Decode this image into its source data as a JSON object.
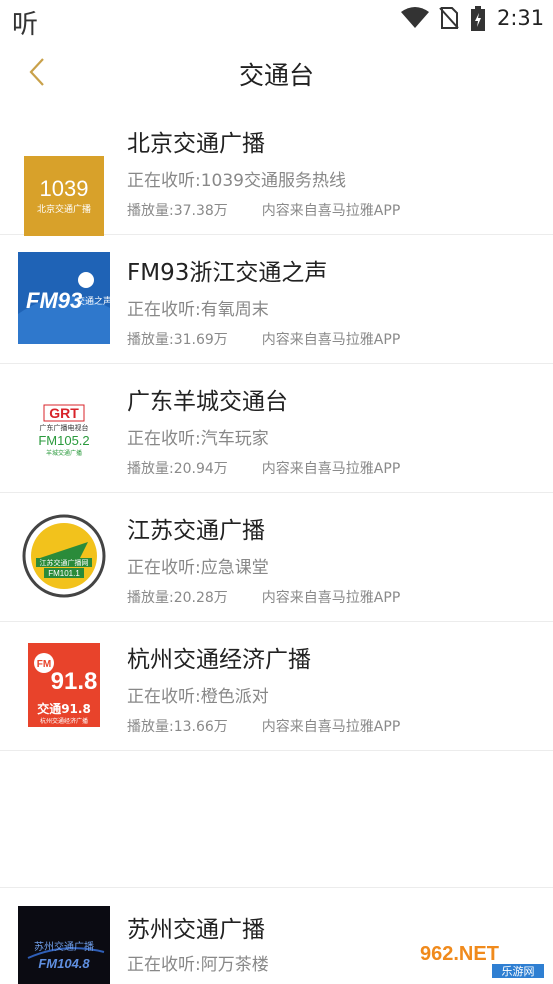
{
  "status_bar": {
    "app_glyph": "听",
    "time": "2:31",
    "icons": [
      "wifi-icon",
      "no-sim-icon",
      "battery-charging-icon"
    ]
  },
  "header": {
    "back_icon": "chevron-left-icon",
    "title": "交通台"
  },
  "stations": [
    {
      "name": "北京交通广播",
      "now_playing_prefix": "正在收听:",
      "now_playing": "1039交通服务热线",
      "plays": "播放量:37.38万",
      "source": "内容来自喜马拉雅APP",
      "logo": {
        "main": "1039",
        "sub": "北京交通广播",
        "bg": "#d8a12a",
        "fg": "#ffffff"
      }
    },
    {
      "name": "FM93浙江交通之声",
      "now_playing_prefix": "正在收听:",
      "now_playing": "有氧周末",
      "plays": "播放量:31.69万",
      "source": "内容来自喜马拉雅APP",
      "logo": {
        "main": "FM93",
        "sub": "交通之声",
        "bg": "#1f63b6",
        "fg": "#ffffff"
      }
    },
    {
      "name": "广东羊城交通台",
      "now_playing_prefix": "正在收听:",
      "now_playing": "汽车玩家",
      "plays": "播放量:20.94万",
      "source": "内容来自喜马拉雅APP",
      "logo": {
        "main": "GRT",
        "sub": "FM105.2",
        "line1": "广东广播电视台",
        "line2": "羊城交通广播",
        "bg": "#ffffff",
        "fg": "#2a9a3c",
        "accent": "#d8232a"
      }
    },
    {
      "name": "江苏交通广播",
      "now_playing_prefix": "正在收听:",
      "now_playing": "应急课堂",
      "plays": "播放量:20.28万",
      "source": "内容来自喜马拉雅APP",
      "logo": {
        "main": "江苏交通广播网",
        "sub": "FM101.1",
        "bg": "#ffffff",
        "fg": "#2a8b3a",
        "accent": "#f2c21c"
      }
    },
    {
      "name": "杭州交通经济广播",
      "now_playing_prefix": "正在收听:",
      "now_playing": "橙色派对",
      "plays": "播放量:13.66万",
      "source": "内容来自喜马拉雅APP",
      "logo": {
        "main": "91.8",
        "badge": "FM",
        "sub": "交通91.8",
        "line1": "杭州交通经济广播",
        "bg": "#e8432b",
        "fg": "#ffffff"
      }
    }
  ],
  "bottom_station": {
    "name": "苏州交通广播",
    "now_playing_prefix": "正在收听:",
    "now_playing": "阿万茶楼",
    "logo": {
      "main": "苏州交通广播",
      "sub": "FM104.8",
      "bg": "#0b0b12",
      "fg": "#5f8fe0"
    }
  },
  "watermark": {
    "main": "962.NET",
    "sub": "乐游网"
  }
}
